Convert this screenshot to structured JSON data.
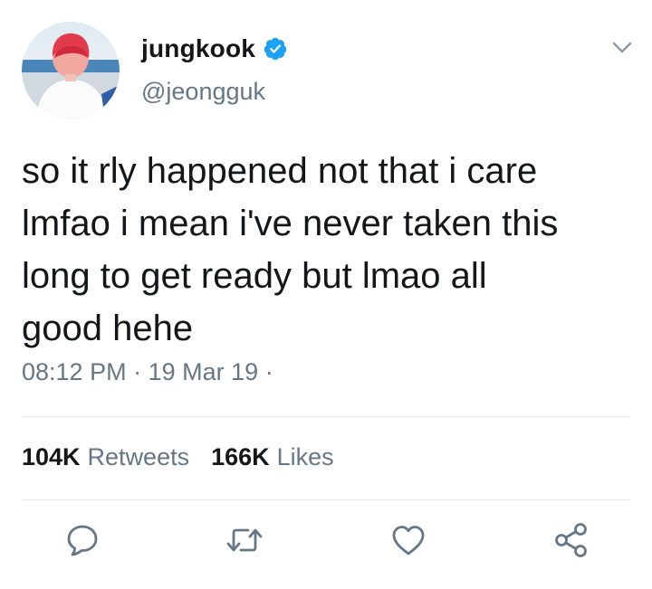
{
  "user": {
    "display_name": "jungkook",
    "handle": "@jeongguk",
    "verified": true,
    "avatar_icon": "profile-photo"
  },
  "tweet": {
    "text": "so it rly happened not that i care\nlmfao i mean i've never taken this\nlong to get ready but lmao all\ngood hehe",
    "time": "08:12 PM",
    "separator": "·",
    "date": "19 Mar 19",
    "trailing_separator": "·"
  },
  "stats": {
    "retweets_count": "104K",
    "retweets_label": "Retweets",
    "likes_count": "166K",
    "likes_label": "Likes"
  },
  "actions": {
    "reply_icon": "reply-icon",
    "retweet_icon": "retweet-icon",
    "like_icon": "heart-icon",
    "share_icon": "share-icon"
  },
  "colors": {
    "primary_text": "#14171a",
    "secondary_text": "#657786",
    "verified_blue": "#1da1f2",
    "divider": "#e1e8ed",
    "icon_gray": "#657786"
  }
}
